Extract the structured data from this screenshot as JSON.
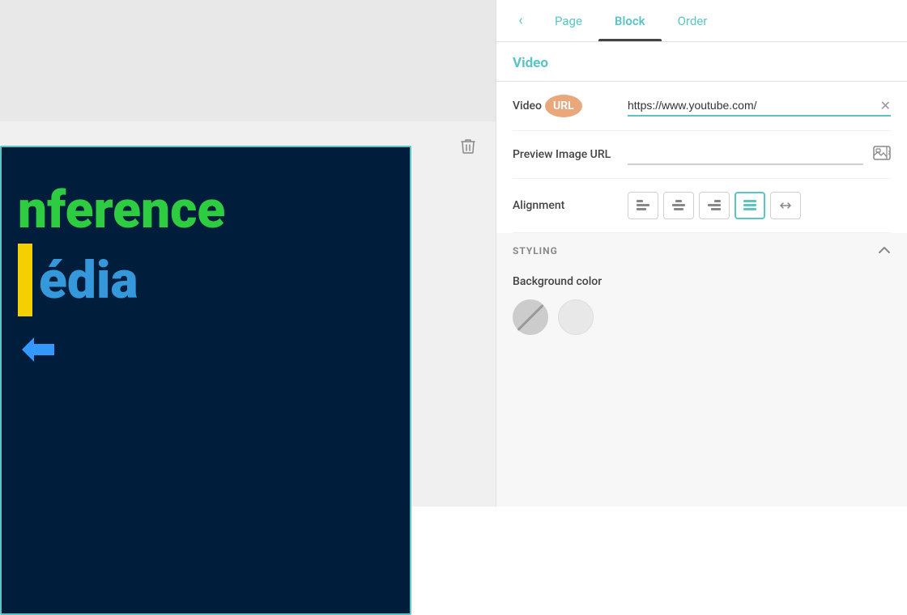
{
  "left_panel": {
    "conference_text_line1": "nference",
    "media_text": "édia"
  },
  "tabs": {
    "back_label": "‹",
    "page_label": "Page",
    "block_label": "Block",
    "order_label": "Order"
  },
  "section": {
    "title": "Video"
  },
  "fields": {
    "video_label": "Video",
    "url_label": "URL",
    "video_value": "https://www.youtube.com/",
    "preview_image_label": "Preview Image URL",
    "preview_placeholder": ""
  },
  "alignment": {
    "label": "Alignment",
    "options": [
      "align-left",
      "align-center-text",
      "align-right",
      "align-full",
      "align-stretch"
    ],
    "selected_index": 3
  },
  "styling": {
    "title": "STYLING",
    "bg_color_label": "Background color",
    "colors": [
      "none",
      "white"
    ]
  },
  "icons": {
    "back": "‹",
    "chevron_up": "∧",
    "clear": "✕",
    "image_browse": "⊞"
  }
}
